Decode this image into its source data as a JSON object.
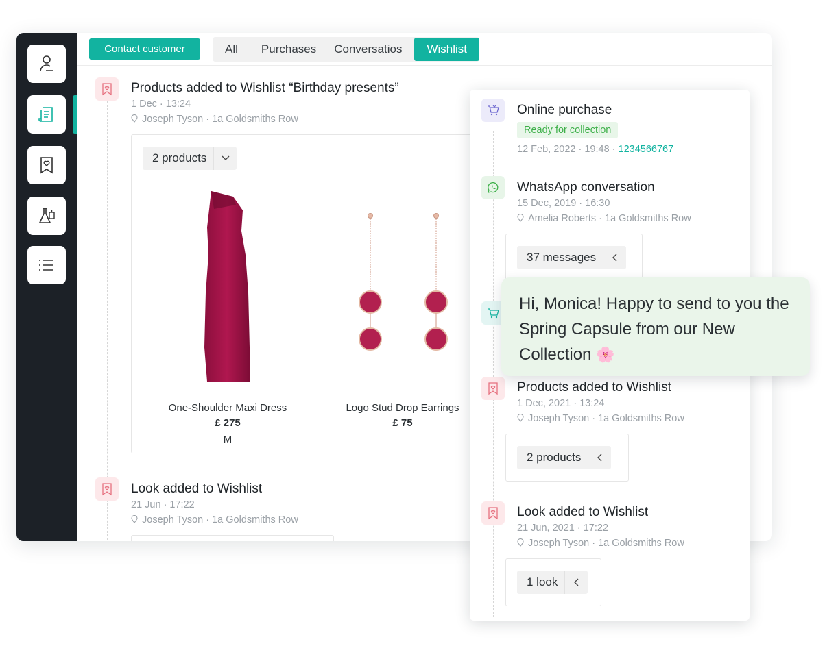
{
  "rail": {
    "items": [
      {
        "name": "customer-profile-icon"
      },
      {
        "name": "timeline-icon",
        "active": true
      },
      {
        "name": "wishlist-icon"
      },
      {
        "name": "beauty-lab-icon"
      },
      {
        "name": "list-icon"
      }
    ]
  },
  "header": {
    "contact_button": "Contact customer",
    "tabs": [
      "All",
      "Purchases",
      "Conversatios",
      "Wishlist"
    ],
    "active_tab": "Wishlist"
  },
  "timeline": {
    "event1": {
      "title": "Products added to Wishlist “Birthday presents”",
      "date": "1 Dec · 13:24",
      "location": "Joseph Tyson · 1a Goldsmiths Row",
      "products_dropdown": "2 products",
      "products": [
        {
          "name": "One-Shoulder Maxi Dress",
          "price": "£ 275",
          "size": "M"
        },
        {
          "name": "Logo Stud Drop Earrings",
          "price": "£ 75"
        }
      ]
    },
    "event2": {
      "title": "Look added to Wishlist",
      "date": "21 Jun · 17:22",
      "location": "Joseph Tyson · 1a Goldsmiths Row"
    }
  },
  "panel": {
    "purchase": {
      "title": "Online purchase",
      "status": "Ready for collection",
      "date": "12 Feb, 2022 · 19:48 · ",
      "order_number": "1234566767"
    },
    "whatsapp": {
      "title": "WhatsApp conversation",
      "date": "15 Dec, 2019 · 16:30",
      "location": "Amelia Roberts · 1a Goldsmiths Row",
      "messages": "37 messages"
    },
    "wishlist": {
      "title": "Products added to Wishlist",
      "date": "1 Dec, 2021 · 13:24",
      "location": "Joseph Tyson · 1a Goldsmiths Row",
      "products": "2 products"
    },
    "look": {
      "title": "Look added to Wishlist",
      "date": "21 Jun, 2021 · 17:22",
      "location": "Joseph Tyson · 1a Goldsmiths Row",
      "count": "1 look"
    }
  },
  "chat_bubble": {
    "text": "Hi, Monica! Happy to send to you the Spring Capsule from our New Collection",
    "emoji": "🌸"
  },
  "colors": {
    "accent": "#12b3a0",
    "rail_bg": "#1c2127",
    "status_green": "#3eb04a",
    "wishlist_icon_bg": "#fde8ea",
    "product_color": "#a0134a"
  }
}
